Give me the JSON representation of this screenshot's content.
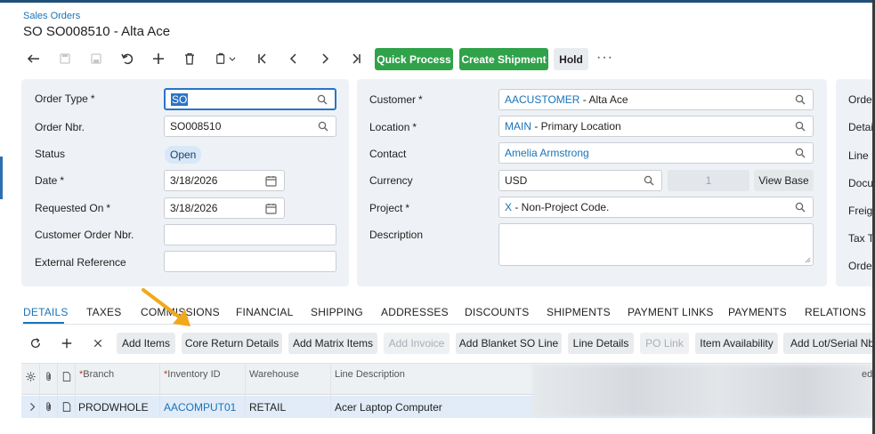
{
  "header": {
    "breadcrumb": "Sales Orders",
    "title": "SO SO008510 - Alta Ace"
  },
  "toolbar": {
    "quick_process": "Quick Process",
    "create_shipment": "Create Shipment",
    "hold": "Hold",
    "more": "···"
  },
  "summary_left": {
    "order_type_label": "Order Type",
    "order_type_value": "SO",
    "order_nbr_label": "Order Nbr.",
    "order_nbr_value": "SO008510",
    "status_label": "Status",
    "status_value": "Open",
    "date_label": "Date",
    "date_value": "3/18/2026",
    "requested_on_label": "Requested On",
    "requested_on_value": "3/18/2026",
    "customer_order_nbr_label": "Customer Order Nbr.",
    "customer_order_nbr_value": "",
    "external_reference_label": "External Reference",
    "external_reference_value": ""
  },
  "summary_mid": {
    "customer_label": "Customer",
    "customer_code": "AACUSTOMER",
    "customer_name": " - Alta Ace",
    "location_label": "Location",
    "location_code": "MAIN",
    "location_name": " - Primary Location",
    "contact_label": "Contact",
    "contact_value": "Amelia Armstrong",
    "currency_label": "Currency",
    "currency_value": "USD",
    "currency_rate": "1",
    "view_base": "View Base",
    "project_label": "Project",
    "project_code": "X",
    "project_name": " - Non-Project Code.",
    "description_label": "Description",
    "description_value": ""
  },
  "summary_right": {
    "labels": [
      "Ordered",
      "Detail",
      "Line D",
      "Docum",
      "Freigh",
      "Tax To",
      "Order"
    ]
  },
  "tabs": [
    "DETAILS",
    "TAXES",
    "COMMISSIONS",
    "FINANCIAL",
    "SHIPPING",
    "ADDRESSES",
    "DISCOUNTS",
    "SHIPMENTS",
    "PAYMENT LINKS",
    "PAYMENTS",
    "RELATIONS"
  ],
  "grid_toolbar": {
    "add_items": "Add Items",
    "core_return_details": "Core Return Details",
    "add_matrix_items": "Add Matrix Items",
    "add_invoice": "Add Invoice",
    "add_blanket_so_line": "Add Blanket SO Line",
    "line_details": "Line Details",
    "po_link": "PO Link",
    "item_availability": "Item Availability",
    "add_lot_serial": "Add Lot/Serial Nbr."
  },
  "grid": {
    "columns": {
      "branch": "Branch",
      "inventory_id": "Inventory ID",
      "warehouse": "Warehouse",
      "line_description": "Line Description",
      "cut": "ed"
    },
    "rows": [
      {
        "branch": "PRODWHOLE",
        "inventory_id": "AACOMPUT01",
        "warehouse": "RETAIL",
        "line_description": "Acer Laptop Computer"
      }
    ]
  },
  "colors": {
    "accent": "#1a73b8",
    "green": "#2fa24a",
    "panel": "#eef2f6",
    "row_selected": "#e1ecf8"
  }
}
